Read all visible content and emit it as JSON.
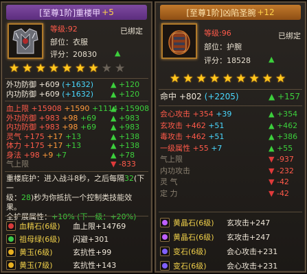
{
  "left": {
    "title": "[至尊1阶]重楼甲",
    "title_plus": "+5",
    "level_label": "等级:",
    "level_value": "92",
    "bound": "已绑定",
    "slot": "部位：衣服",
    "score": "评分：20830",
    "stars_total": 9,
    "stars_filled": 7,
    "base_stats": [
      {
        "name": "外功防御",
        "value": "+609",
        "bonus": "(+1632)",
        "cmp": "+120"
      },
      {
        "name": "内功防御",
        "value": "+609",
        "bonus": "(+1632)",
        "cmp": "+120"
      }
    ],
    "ext_stats": [
      {
        "name": "血上限",
        "v1": "+15908",
        "v2": "+1590",
        "v3": "+1114",
        "cmp": "+15908",
        "dir": "up"
      },
      {
        "name": "外功防御",
        "v1": "+983",
        "v2": "+98",
        "v3": "+69",
        "cmp": "+983",
        "dir": "up"
      },
      {
        "name": "内功防御",
        "v1": "+983",
        "v2": "+98",
        "v3": "+69",
        "cmp": "+983",
        "dir": "up"
      },
      {
        "name": "灵气",
        "v1": "+175",
        "v2": "+17",
        "v3": "+13",
        "cmp": "+138",
        "dir": "up"
      },
      {
        "name": "体力",
        "v1": "+175",
        "v2": "+17",
        "v3": "+13",
        "cmp": "+138",
        "dir": "up"
      },
      {
        "name": "身法",
        "v1": "+98",
        "v2": "+9",
        "v3": "+7",
        "cmp": "+78",
        "dir": "up"
      },
      {
        "name": "气上限",
        "v1": "",
        "v2": "",
        "v3": "",
        "cmp": "-833",
        "dir": "down"
      }
    ],
    "desc_line1": "重楼庇护：进入战斗8秒，之后每隔",
    "desc_num": "32",
    "desc_line1b": "(下一",
    "desc_line2a": "级：",
    "desc_num2": "28",
    "desc_line2b": ")秒为你抵抗一个控制类技能效",
    "desc_line3": "果。",
    "ext_label": "全扩展属性：",
    "ext_value": "+10%",
    "ext_next": "(下一级：+20%)",
    "gems": [
      {
        "name": "血精石(6级)",
        "stat": "血上限+14769",
        "color": "#d83a3a"
      },
      {
        "name": "祖母绿(6级)",
        "stat": "闪避+301",
        "color": "#3ac84a"
      },
      {
        "name": "黄玉(6级)",
        "stat": "玄抗性+99",
        "color": "#e8b020"
      },
      {
        "name": "黄玉(7级)",
        "stat": "玄抗性+143",
        "color": "#e8b020"
      }
    ]
  },
  "right": {
    "title": "[至尊1阶]凶陷圣腕",
    "title_plus": "+12",
    "level_label": "等级:",
    "level_value": "96",
    "bound": "已绑定",
    "slot": "部位：护腕",
    "score": "评分：18528",
    "stars_total": 9,
    "stars_filled": 9,
    "base_stats": [
      {
        "name": "命中",
        "value": "+802",
        "bonus": "(+2205)",
        "cmp": "+157"
      }
    ],
    "ext_stats": [
      {
        "name": "会心攻击",
        "v1": "+354",
        "v2": "+39",
        "cmp": "+354",
        "dir": "up"
      },
      {
        "name": "玄攻击",
        "v1": "+462",
        "v2": "+51",
        "cmp": "+462",
        "dir": "up"
      },
      {
        "name": "毒攻击",
        "v1": "+462",
        "v2": "+51",
        "cmp": "+386",
        "dir": "up"
      },
      {
        "name": "一级属性",
        "v1": "+55",
        "v2": "+7",
        "cmp": "+55",
        "dir": "up"
      },
      {
        "name": "气上限",
        "v1": "",
        "v2": "",
        "cmp": "-937",
        "dir": "down"
      },
      {
        "name": "内功攻击",
        "v1": "",
        "v2": "",
        "cmp": "-232",
        "dir": "down"
      },
      {
        "name": "灵 气",
        "v1": "",
        "v2": "",
        "cmp": "-42",
        "dir": "down"
      },
      {
        "name": "定 力",
        "v1": "",
        "v2": "",
        "cmp": "-42",
        "dir": "down"
      }
    ],
    "gems": [
      {
        "name": "黄晶石(6级)",
        "stat": "玄攻击+247",
        "color": "#c060ff"
      },
      {
        "name": "黄晶石(6级)",
        "stat": "玄攻击+247",
        "color": "#c060ff"
      },
      {
        "name": "变石(6级)",
        "stat": "会心攻击+231",
        "color": "#8060ff"
      },
      {
        "name": "变石(6级)",
        "stat": "会心攻击+231",
        "color": "#8060ff"
      }
    ]
  }
}
